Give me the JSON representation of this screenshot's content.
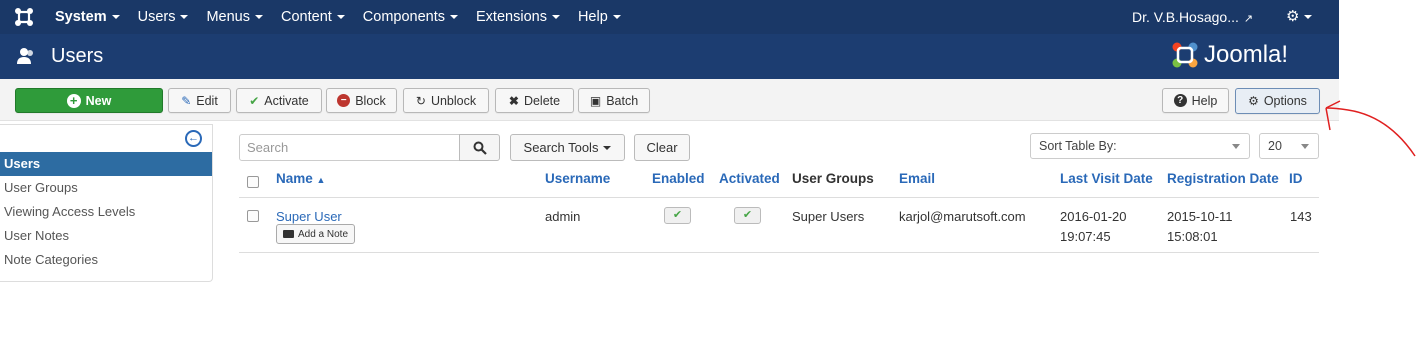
{
  "topnav": {
    "menu": [
      {
        "label": "System",
        "bold": true
      },
      {
        "label": "Users"
      },
      {
        "label": "Menus"
      },
      {
        "label": "Content"
      },
      {
        "label": "Components"
      },
      {
        "label": "Extensions"
      },
      {
        "label": "Help"
      }
    ],
    "user_name": "Dr. V.B.Hosago...",
    "nav_color": "#1a3867"
  },
  "header": {
    "title": "Users",
    "brand": "Joomla!",
    "header_color": "#1c3d71"
  },
  "toolbar": {
    "new_label": "New",
    "edit_label": "Edit",
    "activate_label": "Activate",
    "block_label": "Block",
    "unblock_label": "Unblock",
    "delete_label": "Delete",
    "batch_label": "Batch",
    "help_label": "Help",
    "options_label": "Options"
  },
  "sidebar": {
    "items": [
      {
        "label": "Users",
        "active": true
      },
      {
        "label": "User Groups"
      },
      {
        "label": "Viewing Access Levels"
      },
      {
        "label": "User Notes"
      },
      {
        "label": "Note Categories"
      }
    ]
  },
  "filters": {
    "search_placeholder": "Search",
    "search_tools_label": "Search Tools",
    "clear_label": "Clear",
    "sort_label": "Sort Table By:",
    "limit_value": "20"
  },
  "table": {
    "columns": {
      "name": "Name",
      "username": "Username",
      "enabled": "Enabled",
      "activated": "Activated",
      "user_groups": "User Groups",
      "email": "Email",
      "last_visit": "Last Visit Date",
      "registration": "Registration Date",
      "id": "ID"
    },
    "rows": [
      {
        "name": "Super User",
        "add_note": "Add a Note",
        "username": "admin",
        "enabled": true,
        "activated": true,
        "user_groups": "Super Users",
        "email": "karjol@marutsoft.com",
        "last_visit_date": "2016-01-20",
        "last_visit_time": "19:07:45",
        "registration_date": "2015-10-11",
        "registration_time": "15:08:01",
        "id": "143"
      }
    ]
  },
  "accent_colors": {
    "link": "#2a69b8",
    "new_button": "#2f9b3a",
    "annotation": "#e02020"
  }
}
